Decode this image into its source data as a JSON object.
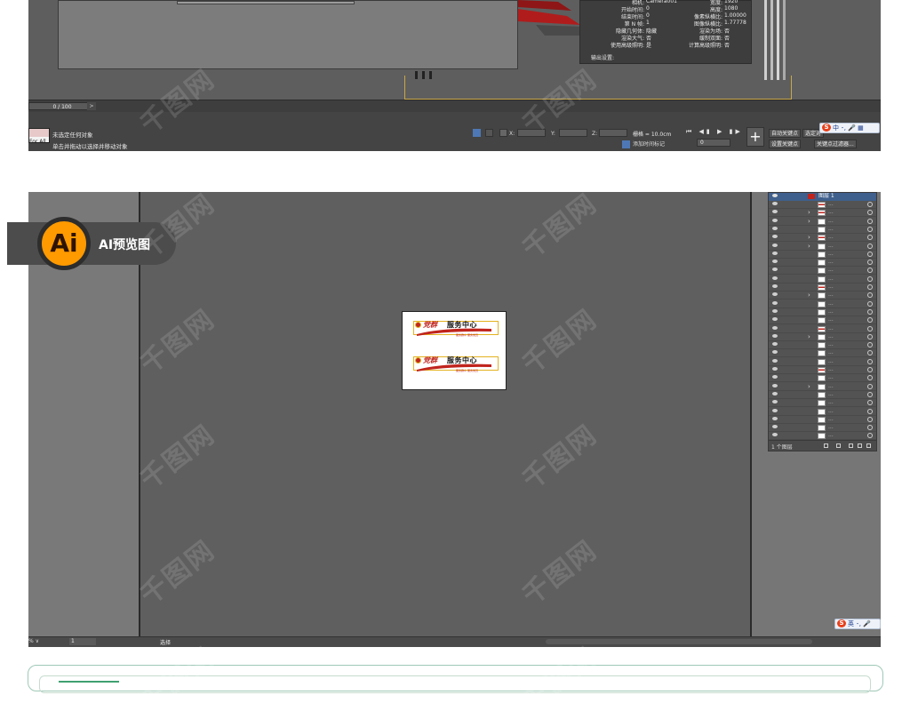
{
  "max_window": {
    "render_info": {
      "rows_left": [
        {
          "label": "相机:",
          "value": "Camera001"
        },
        {
          "label": "开始时间:",
          "value": "0"
        },
        {
          "label": "结束时间:",
          "value": "0"
        },
        {
          "label": "第 N 帧:",
          "value": "1"
        },
        {
          "label": "隐藏几何体:",
          "value": "隐藏"
        },
        {
          "label": "渲染大气:",
          "value": "否"
        },
        {
          "label": "使用高级照明:",
          "value": "是"
        }
      ],
      "rows_right": [
        {
          "label": "宽度:",
          "value": "1920"
        },
        {
          "label": "高度:",
          "value": "1080"
        },
        {
          "label": "像素纵横比:",
          "value": "1.00000"
        },
        {
          "label": "图像纵横比:",
          "value": "1.77778"
        },
        {
          "label": "渲染为场:",
          "value": "否"
        },
        {
          "label": "缓制双面:",
          "value": "否"
        },
        {
          "label": "计算高级照明:",
          "value": "否"
        }
      ],
      "output_label": "输出设置:"
    },
    "timeline": {
      "frame_counter": "0 / 100",
      "next": ">"
    },
    "status": {
      "swatch_text": "For All",
      "line1": "未选定任何对象",
      "line2": "单击并拖动以选择并移动对象"
    },
    "coords": {
      "x_label": "X:",
      "y_label": "Y:",
      "z_label": "Z:"
    },
    "grid": "栅格 = 10.0cm",
    "add_time_tag": "添加时间标记",
    "playback_icons": "⏮ ◀▮ ▶ ▮▶ ⏭",
    "frame_value": "0",
    "key_buttons": {
      "auto_key": "自动关键点",
      "selected": "选定对",
      "set_key": "设置关键点",
      "key_filters": "关键点过滤器..."
    },
    "ime_top": {
      "s": "S",
      "text": "中 ･, 🎤 ▦"
    }
  },
  "ai_window": {
    "badge": {
      "logo": "Ai",
      "label": "AI预览图"
    },
    "layers": {
      "header_label": "图层 1",
      "rows": [
        {
          "arrow": "",
          "thumb": "red"
        },
        {
          "arrow": "›",
          "thumb": "red"
        },
        {
          "arrow": "›",
          "thumb": "white"
        },
        {
          "arrow": "",
          "thumb": "white"
        },
        {
          "arrow": "›",
          "thumb": "red"
        },
        {
          "arrow": "›",
          "thumb": "white"
        },
        {
          "arrow": "",
          "thumb": "white"
        },
        {
          "arrow": "",
          "thumb": "white"
        },
        {
          "arrow": "",
          "thumb": "white"
        },
        {
          "arrow": "",
          "thumb": "white"
        },
        {
          "arrow": "",
          "thumb": "red"
        },
        {
          "arrow": "›",
          "thumb": "white"
        },
        {
          "arrow": "",
          "thumb": "white"
        },
        {
          "arrow": "",
          "thumb": "white"
        },
        {
          "arrow": "",
          "thumb": "white"
        },
        {
          "arrow": "",
          "thumb": "red"
        },
        {
          "arrow": "›",
          "thumb": "white"
        },
        {
          "arrow": "",
          "thumb": "white"
        },
        {
          "arrow": "",
          "thumb": "white"
        },
        {
          "arrow": "",
          "thumb": "white"
        },
        {
          "arrow": "",
          "thumb": "red"
        },
        {
          "arrow": "",
          "thumb": "white"
        },
        {
          "arrow": "›",
          "thumb": "white"
        },
        {
          "arrow": "",
          "thumb": "white"
        },
        {
          "arrow": "",
          "thumb": "white"
        },
        {
          "arrow": "",
          "thumb": "white"
        },
        {
          "arrow": "",
          "thumb": "white"
        },
        {
          "arrow": "",
          "thumb": "white"
        },
        {
          "arrow": "",
          "thumb": "white"
        }
      ],
      "dots": "...",
      "footer_count": "1 个图层"
    },
    "artboard": {
      "signs": [
        {
          "script": "党群",
          "title": "服务中心",
          "sub": "服务群众 服务党员"
        },
        {
          "script": "党群",
          "title": "服务中心",
          "sub": "服务群众 服务党员"
        }
      ]
    },
    "statusbar": {
      "zoom": "% ∨",
      "page": "1",
      "tool": "选择"
    },
    "ime_bottom": {
      "s": "S",
      "text": "英 ･, 🎤"
    }
  },
  "watermark": "千图网",
  "colors": {
    "accent_red": "#c0241d",
    "accent_gold": "#e4b321",
    "ai_orange": "#ff9a00",
    "frame_green": "#9fc9b8"
  }
}
